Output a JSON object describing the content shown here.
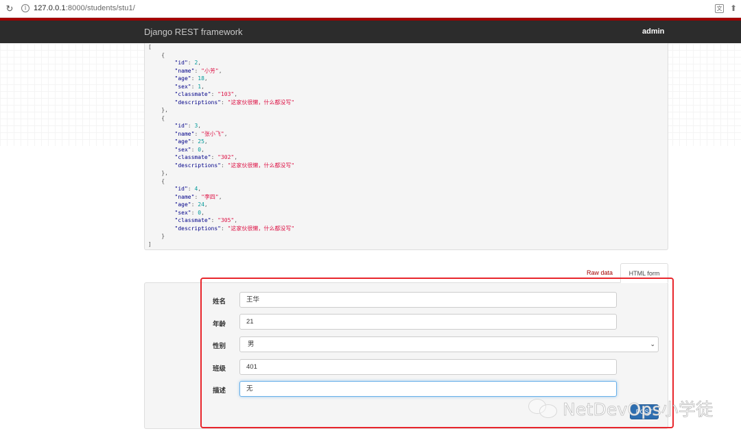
{
  "browser": {
    "url_host": "127.0.0.1",
    "url_path": ":8000/students/stu1/"
  },
  "navbar": {
    "brand": "Django REST framework",
    "user": "admin"
  },
  "response_lines": [
    [
      [
        "p",
        "["
      ]
    ],
    [
      [
        "p",
        "    {"
      ]
    ],
    [
      [
        "p",
        "        "
      ],
      [
        "k",
        "\"id\""
      ],
      [
        "p",
        ": "
      ],
      [
        "n",
        "2"
      ],
      [
        "p",
        ","
      ]
    ],
    [
      [
        "p",
        "        "
      ],
      [
        "k",
        "\"name\""
      ],
      [
        "p",
        ": "
      ],
      [
        "s",
        "\"小芳\""
      ],
      [
        "p",
        ","
      ]
    ],
    [
      [
        "p",
        "        "
      ],
      [
        "k",
        "\"age\""
      ],
      [
        "p",
        ": "
      ],
      [
        "n",
        "18"
      ],
      [
        "p",
        ","
      ]
    ],
    [
      [
        "p",
        "        "
      ],
      [
        "k",
        "\"sex\""
      ],
      [
        "p",
        ": "
      ],
      [
        "n",
        "1"
      ],
      [
        "p",
        ","
      ]
    ],
    [
      [
        "p",
        "        "
      ],
      [
        "k",
        "\"classmate\""
      ],
      [
        "p",
        ": "
      ],
      [
        "s",
        "\"103\""
      ],
      [
        "p",
        ","
      ]
    ],
    [
      [
        "p",
        "        "
      ],
      [
        "k",
        "\"descriptions\""
      ],
      [
        "p",
        ": "
      ],
      [
        "s",
        "\"这家伙很懒，什么都没写\""
      ]
    ],
    [
      [
        "p",
        "    },"
      ]
    ],
    [
      [
        "p",
        "    {"
      ]
    ],
    [
      [
        "p",
        "        "
      ],
      [
        "k",
        "\"id\""
      ],
      [
        "p",
        ": "
      ],
      [
        "n",
        "3"
      ],
      [
        "p",
        ","
      ]
    ],
    [
      [
        "p",
        "        "
      ],
      [
        "k",
        "\"name\""
      ],
      [
        "p",
        ": "
      ],
      [
        "s",
        "\"张小飞\""
      ],
      [
        "p",
        ","
      ]
    ],
    [
      [
        "p",
        "        "
      ],
      [
        "k",
        "\"age\""
      ],
      [
        "p",
        ": "
      ],
      [
        "n",
        "25"
      ],
      [
        "p",
        ","
      ]
    ],
    [
      [
        "p",
        "        "
      ],
      [
        "k",
        "\"sex\""
      ],
      [
        "p",
        ": "
      ],
      [
        "n",
        "0"
      ],
      [
        "p",
        ","
      ]
    ],
    [
      [
        "p",
        "        "
      ],
      [
        "k",
        "\"classmate\""
      ],
      [
        "p",
        ": "
      ],
      [
        "s",
        "\"302\""
      ],
      [
        "p",
        ","
      ]
    ],
    [
      [
        "p",
        "        "
      ],
      [
        "k",
        "\"descriptions\""
      ],
      [
        "p",
        ": "
      ],
      [
        "s",
        "\"这家伙很懒，什么都没写\""
      ]
    ],
    [
      [
        "p",
        "    },"
      ]
    ],
    [
      [
        "p",
        "    {"
      ]
    ],
    [
      [
        "p",
        "        "
      ],
      [
        "k",
        "\"id\""
      ],
      [
        "p",
        ": "
      ],
      [
        "n",
        "4"
      ],
      [
        "p",
        ","
      ]
    ],
    [
      [
        "p",
        "        "
      ],
      [
        "k",
        "\"name\""
      ],
      [
        "p",
        ": "
      ],
      [
        "s",
        "\"李四\""
      ],
      [
        "p",
        ","
      ]
    ],
    [
      [
        "p",
        "        "
      ],
      [
        "k",
        "\"age\""
      ],
      [
        "p",
        ": "
      ],
      [
        "n",
        "24"
      ],
      [
        "p",
        ","
      ]
    ],
    [
      [
        "p",
        "        "
      ],
      [
        "k",
        "\"sex\""
      ],
      [
        "p",
        ": "
      ],
      [
        "n",
        "0"
      ],
      [
        "p",
        ","
      ]
    ],
    [
      [
        "p",
        "        "
      ],
      [
        "k",
        "\"classmate\""
      ],
      [
        "p",
        ": "
      ],
      [
        "s",
        "\"305\""
      ],
      [
        "p",
        ","
      ]
    ],
    [
      [
        "p",
        "        "
      ],
      [
        "k",
        "\"descriptions\""
      ],
      [
        "p",
        ": "
      ],
      [
        "s",
        "\"这家伙很懒，什么都没写\""
      ]
    ],
    [
      [
        "p",
        "    }"
      ]
    ],
    [
      [
        "p",
        "]"
      ]
    ]
  ],
  "tabs": {
    "raw": "Raw data",
    "html": "HTML form"
  },
  "form": {
    "name_label": "姓名",
    "name_value": "王华",
    "age_label": "年龄",
    "age_value": "21",
    "sex_label": "性别",
    "sex_value": "男",
    "class_label": "班级",
    "class_value": "401",
    "desc_label": "描述",
    "desc_value": "无",
    "submit_label": "POST"
  },
  "watermark": "NetDevOps小学徒",
  "colors": {
    "brand_red": "#a30000",
    "highlight_red": "#e8242a",
    "submit_blue": "#2c6db0"
  }
}
